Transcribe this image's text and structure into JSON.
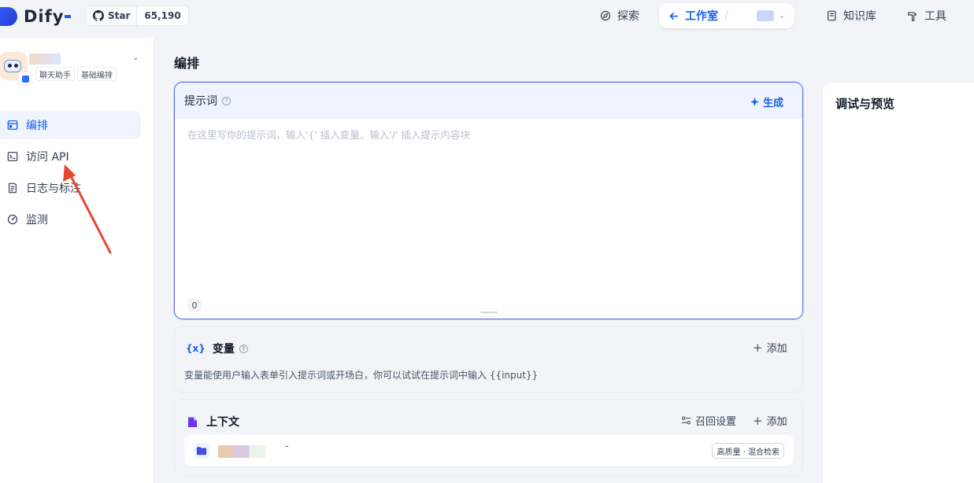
{
  "header": {
    "logo_text": "Dify",
    "github": {
      "star_label": "Star",
      "count": "65,190"
    },
    "nav": {
      "explore": "探索",
      "studio": "工作室",
      "studio_sep": "/",
      "knowledge": "知识库",
      "tools": "工具"
    }
  },
  "sidebar": {
    "app": {
      "tags": [
        "聊天助手",
        "基础编排"
      ]
    },
    "items": [
      {
        "label": "编排",
        "icon": "layout-icon",
        "active": true
      },
      {
        "label": "访问 API",
        "icon": "terminal-icon",
        "active": false
      },
      {
        "label": "日志与标注",
        "icon": "file-list-icon",
        "active": false
      },
      {
        "label": "监测",
        "icon": "gauge-icon",
        "active": false
      }
    ]
  },
  "main": {
    "title": "编排",
    "prompt": {
      "label": "提示词",
      "help": "?",
      "generate": "生成",
      "placeholder": "在这里写你的提示词，输入'{' 插入变量、输入'/' 插入提示内容块",
      "count": "0"
    },
    "variables": {
      "title": "变量",
      "help": "?",
      "add": "添加",
      "description": "变量能使用户输入表单引入提示词或开场白，你可以试试在提示词中输入 {{input}}"
    },
    "context": {
      "title": "上下文",
      "retrieval_settings": "召回设置",
      "add": "添加",
      "dataset_dash": "-",
      "badge": "高质量 · 混合检索"
    },
    "debug": {
      "title": "调试与预览"
    }
  },
  "colors": {
    "accent": "#155eef",
    "active_bg": "#eff4ff",
    "prompt_border": "#5a6ef5",
    "annotation_arrow": "#e8472f"
  }
}
